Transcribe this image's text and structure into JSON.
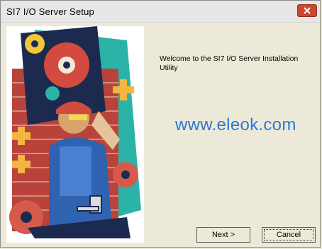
{
  "window": {
    "title": "SI7 I/O Server Setup"
  },
  "icons": {
    "close": "close-icon",
    "illustration": "setup-illustration"
  },
  "content": {
    "welcome_text": "Welcome to the SI7 I/O Server Installation Utility",
    "watermark": "www.eleok.com"
  },
  "buttons": {
    "next_label": "Next >",
    "cancel_label": "Cancel"
  },
  "colors": {
    "title_bar": "#e7e7e7",
    "close_button": "#c9482f",
    "watermark": "#2b7ad6",
    "dialog_background": "#ece9d8"
  }
}
